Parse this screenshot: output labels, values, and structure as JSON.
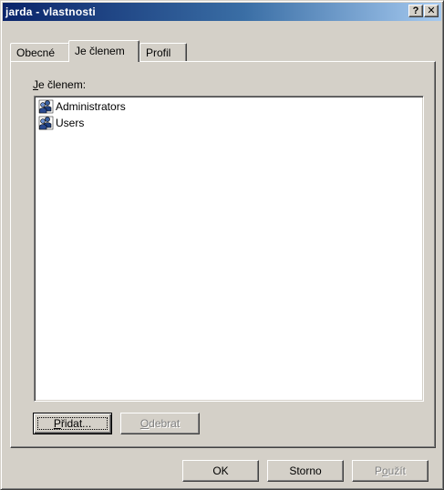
{
  "window": {
    "title": "jarda - vlastnosti",
    "help_button": "?",
    "close_button": "✕"
  },
  "tabs": [
    {
      "label": "Obecné",
      "selected": false
    },
    {
      "label": "Je členem",
      "selected": true
    },
    {
      "label": "Profil",
      "selected": false
    }
  ],
  "member_of": {
    "label_prefix": "",
    "label_access": "J",
    "label_rest": "e členem:",
    "items": [
      {
        "label": "Administrators",
        "icon": "group-icon"
      },
      {
        "label": "Users",
        "icon": "group-icon"
      }
    ],
    "add_button": {
      "pre": "",
      "access": "P",
      "post": "řidat..."
    },
    "remove_button": {
      "pre": "",
      "access": "O",
      "post": "debrat",
      "disabled": true
    }
  },
  "footer": {
    "ok": "OK",
    "cancel": "Storno",
    "apply": {
      "pre": "P",
      "access": "o",
      "post": "užít",
      "disabled": true
    }
  }
}
